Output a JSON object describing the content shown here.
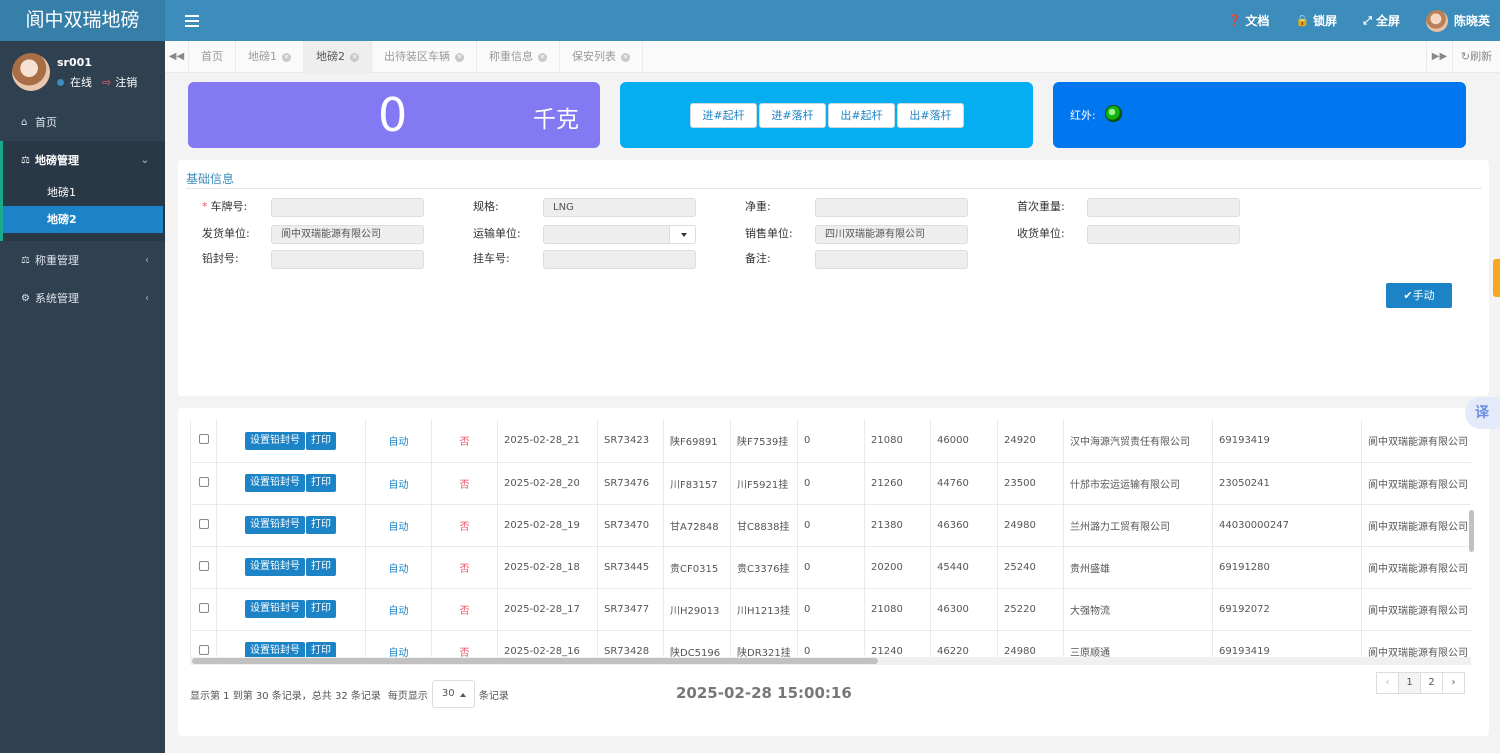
{
  "app": {
    "title": "阆中双瑞地磅"
  },
  "header": {
    "docs": "文档",
    "lock": "锁屏",
    "fullscreen": "全屏",
    "username": "陈晓英"
  },
  "sidebar": {
    "user": {
      "name": "sr001",
      "status": "在线",
      "logout": "注销"
    },
    "home": "首页",
    "weighbridge_group": "地磅管理",
    "sub_items": [
      "地磅1",
      "地磅2"
    ],
    "weighing": "称重管理",
    "system": "系统管理"
  },
  "tabs": {
    "items": [
      "首页",
      "地磅1",
      "地磅2",
      "出待装区车辆",
      "称重信息",
      "保安列表"
    ],
    "active": "地磅2",
    "refresh": "刷新"
  },
  "weight": {
    "value": "0",
    "unit": "千克"
  },
  "gates": [
    "进#起杆",
    "进#落杆",
    "出#起杆",
    "出#落杆"
  ],
  "infrared": {
    "label": "红外:",
    "status_color": "#13b40f"
  },
  "form": {
    "title": "基础信息",
    "plate_label": "车牌号:",
    "spec_label": "规格:",
    "spec_value": "LNG",
    "net_label": "净重:",
    "first_weight_label": "首次重量:",
    "shipper_label": "发货单位:",
    "shipper_value": "阆中双瑞能源有限公司",
    "carrier_label": "运输单位:",
    "seller_label": "销售单位:",
    "seller_value": "四川双瑞能源有限公司",
    "receiver_label": "收货单位:",
    "seal_label": "铅封号:",
    "trailer_label": "挂车号:",
    "remark_label": "备注:",
    "manual_btn": "✔手动"
  },
  "table": {
    "btn_seal": "设置铅封号",
    "btn_print": "打印",
    "rows": [
      [
        "自动",
        "否",
        "2025-02-28_21",
        "SR73423",
        "陕F69891",
        "陕F7539挂",
        "0",
        "21080",
        "46000",
        "24920",
        "汉中海源汽贸责任有限公司",
        "69193419",
        "阆中双瑞能源有限公司"
      ],
      [
        "自动",
        "否",
        "2025-02-28_20",
        "SR73476",
        "川F83157",
        "川F5921挂",
        "0",
        "21260",
        "44760",
        "23500",
        "什邡市宏运运输有限公司",
        "23050241",
        "阆中双瑞能源有限公司"
      ],
      [
        "自动",
        "否",
        "2025-02-28_19",
        "SR73470",
        "甘A72848",
        "甘C8838挂",
        "0",
        "21380",
        "46360",
        "24980",
        "兰州潞力工贸有限公司",
        "44030000247",
        "阆中双瑞能源有限公司"
      ],
      [
        "自动",
        "否",
        "2025-02-28_18",
        "SR73445",
        "贵CF0315",
        "贵C3376挂",
        "0",
        "20200",
        "45440",
        "25240",
        "贵州盛雄",
        "69191280",
        "阆中双瑞能源有限公司"
      ],
      [
        "自动",
        "否",
        "2025-02-28_17",
        "SR73477",
        "川H29013",
        "川H1213挂",
        "0",
        "21080",
        "46300",
        "25220",
        "大强物流",
        "69192072",
        "阆中双瑞能源有限公司"
      ],
      [
        "自动",
        "否",
        "2025-02-28_16",
        "SR73428",
        "陕DC5196",
        "陕DR321挂",
        "0",
        "21240",
        "46220",
        "24980",
        "三原顺通",
        "69193419",
        "阆中双瑞能源有限公司"
      ]
    ]
  },
  "pagination": {
    "info_prefix": "显示第 1 到第 30 条记录，总共 32 条记录",
    "per_page_prefix": "每页显示",
    "per_page": "30",
    "per_page_suffix": "条记录",
    "prev": "‹",
    "pages": [
      "1",
      "2"
    ],
    "next": "›"
  },
  "clock": "2025-02-28 15:00:16",
  "translate": "译"
}
